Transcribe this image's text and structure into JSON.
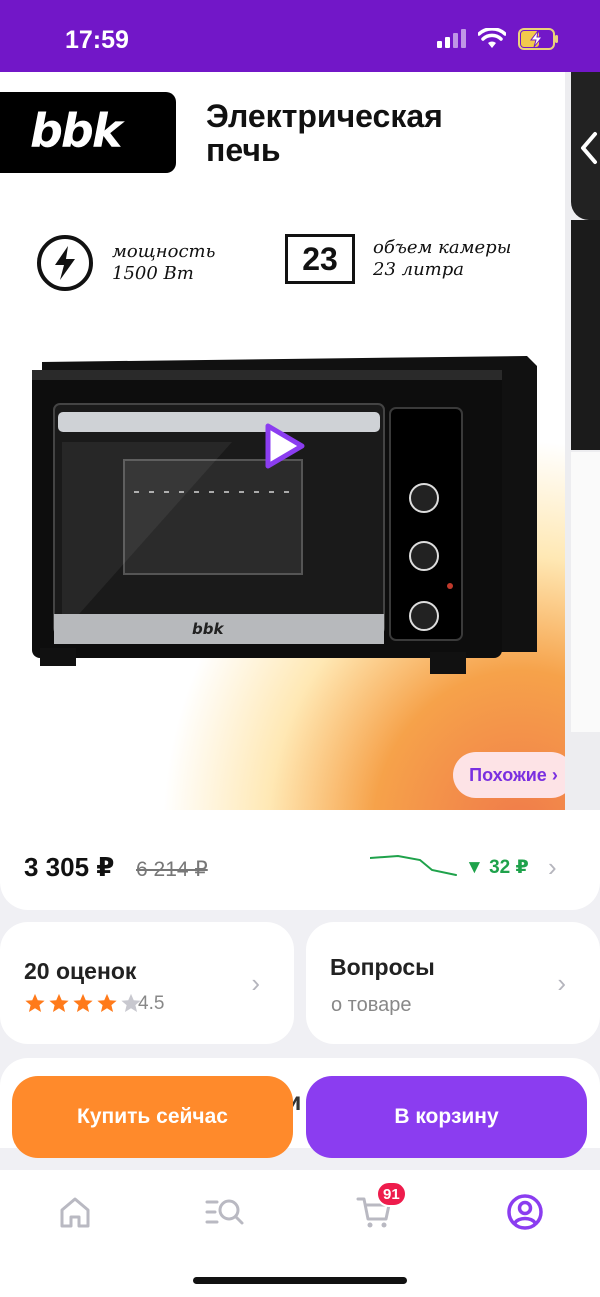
{
  "status_bar": {
    "time": "17:59"
  },
  "hero": {
    "brand": "bbk",
    "title_line1": "Электрическая",
    "title_line2": "печь",
    "spec_power_label": "мощность",
    "spec_power_value": "1500 Вт",
    "spec_volume_badge": "23",
    "spec_volume_label": "объем камеры",
    "spec_volume_value": "23 литра",
    "oven_brand": "bbk",
    "similar_button": "Похожие ›"
  },
  "price": {
    "current": "3 305 ₽",
    "old": "6 214 ₽",
    "change": "▼ 32 ₽",
    "chevron": "›"
  },
  "rating": {
    "title": "20 оценок",
    "value": "4.5",
    "stars": 4.5,
    "chevron": "›"
  },
  "questions": {
    "title": "Вопросы",
    "subtitle": "о товаре",
    "chevron": "›"
  },
  "peek": {
    "text": "и"
  },
  "actions": {
    "buy_now": "Купить сейчас",
    "add_to_cart": "В корзину"
  },
  "tabbar": {
    "cart_badge": "91"
  },
  "colors": {
    "accent": "#7217c8",
    "orange": "#ff8a2b",
    "purple_button": "#8b3df0",
    "green": "#1fa24b",
    "badge": "#ee1c4c"
  }
}
